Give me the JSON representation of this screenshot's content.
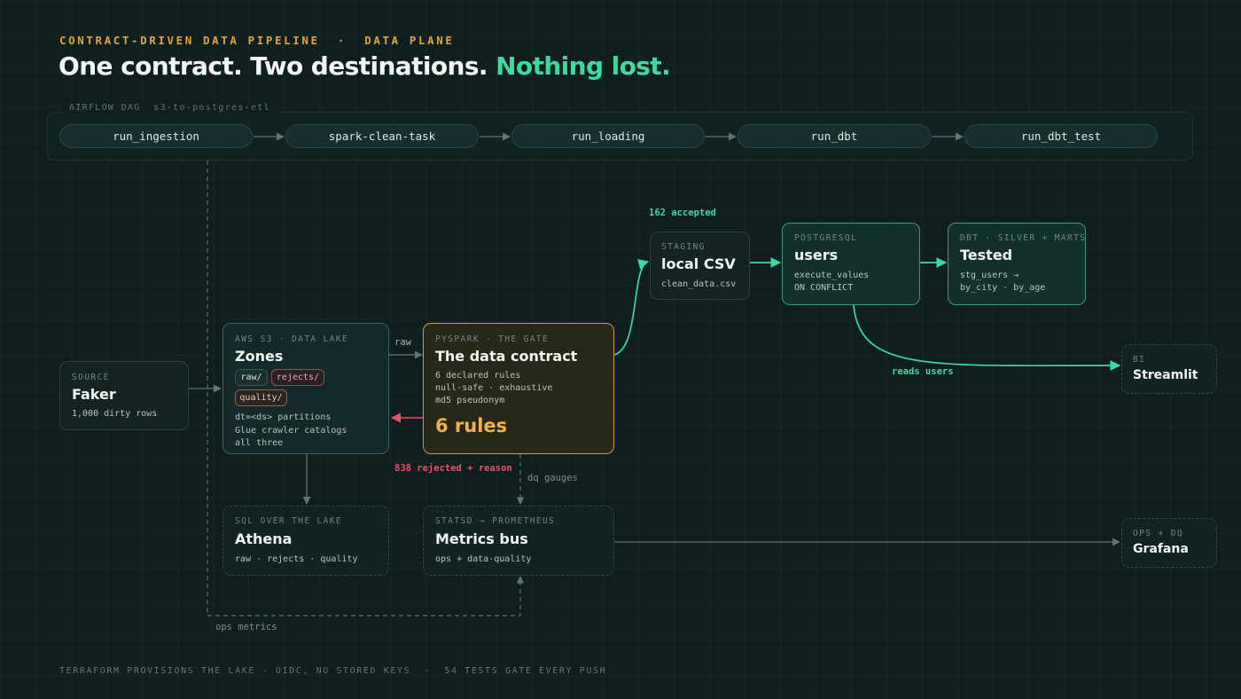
{
  "header": {
    "eyebrow": "CONTRACT-DRIVEN DATA PIPELINE  ·  DATA PLANE",
    "title_main": "One contract. Two destinations. ",
    "title_accent": "Nothing lost."
  },
  "dag": {
    "label": "AIRFLOW DAG  s3-to-postgres-etl",
    "tasks": [
      "run_ingestion",
      "spark-clean-task",
      "run_loading",
      "run_dbt",
      "run_dbt_test"
    ]
  },
  "nodes": {
    "source": {
      "kicker": "SOURCE",
      "title": "Faker",
      "lines": [
        "1,000 dirty rows"
      ]
    },
    "s3": {
      "kicker": "AWS S3 · DATA LAKE",
      "title": "Zones",
      "chips": [
        "raw/",
        "rejects/",
        "quality/"
      ],
      "lines": [
        "dt=<ds> partitions",
        "Glue crawler catalogs",
        "all three"
      ]
    },
    "gate": {
      "kicker": "PYSPARK · THE GATE",
      "title": "The data contract",
      "lines": [
        "6 declared rules",
        "null-safe · exhaustive",
        "md5 pseudonym"
      ],
      "big": "6 rules"
    },
    "staging": {
      "kicker": "STAGING",
      "title": "local CSV",
      "lines": [
        "clean_data.csv"
      ]
    },
    "postgres": {
      "kicker": "POSTGRESQL",
      "title": "users",
      "lines": [
        "execute_values",
        "ON CONFLICT"
      ]
    },
    "dbt": {
      "kicker": "DBT · SILVER + MARTS",
      "title": "Tested",
      "lines": [
        "stg_users →",
        "by_city · by_age"
      ]
    },
    "bi": {
      "kicker": "BI",
      "title": "Streamlit"
    },
    "athena": {
      "kicker": "SQL OVER THE LAKE",
      "title": "Athena",
      "lines": [
        "raw · rejects · quality"
      ]
    },
    "metrics": {
      "kicker": "STATSD → PROMETHEUS",
      "title": "Metrics bus",
      "lines": [
        "ops + data-quality"
      ]
    },
    "grafana": {
      "kicker": "OPS + DQ",
      "title": "Grafana"
    }
  },
  "edges": {
    "accepted": "162 accepted",
    "raw": "raw",
    "rejected": "838 rejected + reason",
    "dq_gauges": "dq gauges",
    "reads_users": "reads users",
    "ops_metrics": "ops metrics"
  },
  "footer": "TERRAFORM PROVISIONS THE LAKE · OIDC, NO STORED KEYS  ·  54 TESTS GATE EVERY PUSH",
  "colors": {
    "background": "#0f1e1f",
    "accent_green": "#3ed9a0",
    "accent_amber": "#f0b24a",
    "reject_red": "#ee4f6d",
    "eyebrow_amber": "#e2a33d"
  }
}
